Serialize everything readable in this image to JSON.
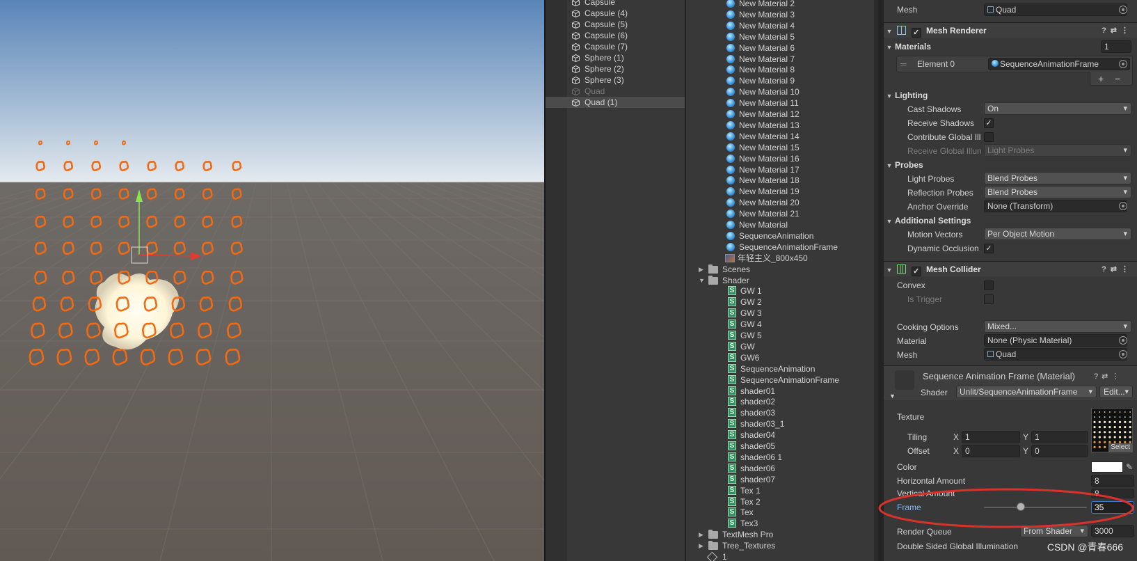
{
  "hierarchy": {
    "items": [
      {
        "label": "Capsule",
        "state": "normal"
      },
      {
        "label": "Capsule (4)",
        "state": "normal"
      },
      {
        "label": "Capsule (5)",
        "state": "normal"
      },
      {
        "label": "Capsule (6)",
        "state": "normal"
      },
      {
        "label": "Capsule (7)",
        "state": "normal"
      },
      {
        "label": "Sphere (1)",
        "state": "normal"
      },
      {
        "label": "Sphere (2)",
        "state": "normal"
      },
      {
        "label": "Sphere (3)",
        "state": "normal"
      },
      {
        "label": "Quad",
        "state": "disabled"
      },
      {
        "label": "Quad (1)",
        "state": "selected"
      }
    ]
  },
  "project": {
    "items": [
      {
        "label": "New Material 2",
        "icon": "sphere"
      },
      {
        "label": "New Material 3",
        "icon": "sphere"
      },
      {
        "label": "New Material 4",
        "icon": "sphere"
      },
      {
        "label": "New Material 5",
        "icon": "sphere"
      },
      {
        "label": "New Material 6",
        "icon": "sphere"
      },
      {
        "label": "New Material 7",
        "icon": "sphere"
      },
      {
        "label": "New Material 8",
        "icon": "sphere"
      },
      {
        "label": "New Material 9",
        "icon": "sphere"
      },
      {
        "label": "New Material 10",
        "icon": "sphere"
      },
      {
        "label": "New Material 11",
        "icon": "sphere"
      },
      {
        "label": "New Material 12",
        "icon": "sphere"
      },
      {
        "label": "New Material 13",
        "icon": "sphere"
      },
      {
        "label": "New Material 14",
        "icon": "sphere"
      },
      {
        "label": "New Material 15",
        "icon": "sphere"
      },
      {
        "label": "New Material 16",
        "icon": "sphere"
      },
      {
        "label": "New Material 17",
        "icon": "sphere"
      },
      {
        "label": "New Material 18",
        "icon": "sphere"
      },
      {
        "label": "New Material 19",
        "icon": "sphere"
      },
      {
        "label": "New Material 20",
        "icon": "sphere"
      },
      {
        "label": "New Material 21",
        "icon": "sphere"
      },
      {
        "label": "New Material",
        "icon": "sphere"
      },
      {
        "label": "SequenceAnimation",
        "icon": "sphere"
      },
      {
        "label": "SequenceAnimationFrame",
        "icon": "sphere"
      },
      {
        "label": "年轻主义_800x450",
        "icon": "image"
      },
      {
        "label": "Scenes",
        "icon": "folder",
        "expanded": false
      },
      {
        "label": "Shader",
        "icon": "folder",
        "expanded": true
      },
      {
        "label": "GW 1",
        "icon": "shader"
      },
      {
        "label": "GW 2",
        "icon": "shader"
      },
      {
        "label": "GW 3",
        "icon": "shader"
      },
      {
        "label": "GW 4",
        "icon": "shader"
      },
      {
        "label": "GW 5",
        "icon": "shader"
      },
      {
        "label": "GW",
        "icon": "shader"
      },
      {
        "label": "GW6",
        "icon": "shader"
      },
      {
        "label": "SequenceAnimation",
        "icon": "shader"
      },
      {
        "label": "SequenceAnimationFrame",
        "icon": "shader"
      },
      {
        "label": "shader01",
        "icon": "shader"
      },
      {
        "label": "shader02",
        "icon": "shader"
      },
      {
        "label": "shader03",
        "icon": "shader"
      },
      {
        "label": "shader03_1",
        "icon": "shader"
      },
      {
        "label": "shader04",
        "icon": "shader"
      },
      {
        "label": "shader05",
        "icon": "shader"
      },
      {
        "label": "shader06 1",
        "icon": "shader"
      },
      {
        "label": "shader06",
        "icon": "shader"
      },
      {
        "label": "shader07",
        "icon": "shader"
      },
      {
        "label": "Tex 1",
        "icon": "shader"
      },
      {
        "label": "Tex 2",
        "icon": "shader"
      },
      {
        "label": "Tex",
        "icon": "shader"
      },
      {
        "label": "Tex3",
        "icon": "shader"
      },
      {
        "label": "TextMesh Pro",
        "icon": "folder",
        "expanded": false
      },
      {
        "label": "Tree_Textures",
        "icon": "folder",
        "expanded": false
      },
      {
        "label": "1",
        "icon": "unity"
      }
    ]
  },
  "inspector": {
    "mesh_filter": {
      "mesh_label": "Mesh",
      "mesh_value": "Quad"
    },
    "mesh_renderer": {
      "title": "Mesh Renderer",
      "materials_label": "Materials",
      "materials_count": "1",
      "element0_label": "Element 0",
      "element0_value": "SequenceAnimationFrame",
      "lighting_label": "Lighting",
      "cast_shadows_label": "Cast Shadows",
      "cast_shadows_value": "On",
      "receive_shadows_label": "Receive Shadows",
      "contribute_gi_label": "Contribute Global Ill",
      "receive_gi_label": "Receive Global Illun",
      "receive_gi_value": "Light Probes",
      "probes_label": "Probes",
      "light_probes_label": "Light Probes",
      "light_probes_value": "Blend Probes",
      "reflection_probes_label": "Reflection Probes",
      "reflection_probes_value": "Blend Probes",
      "anchor_override_label": "Anchor Override",
      "anchor_override_value": "None (Transform)",
      "additional_label": "Additional Settings",
      "motion_vectors_label": "Motion Vectors",
      "motion_vectors_value": "Per Object Motion",
      "dynamic_occlusion_label": "Dynamic Occlusion"
    },
    "mesh_collider": {
      "title": "Mesh Collider",
      "convex_label": "Convex",
      "is_trigger_label": "Is Trigger",
      "cooking_label": "Cooking Options",
      "cooking_value": "Mixed...",
      "material_label": "Material",
      "material_value": "None (Physic Material)",
      "mesh_label": "Mesh",
      "mesh_value": "Quad"
    },
    "material": {
      "title": "Sequence Animation Frame (Material)",
      "shader_label": "Shader",
      "shader_value": "Unlit/SequenceAnimationFrame",
      "edit_label": "Edit...",
      "texture_label": "Texture",
      "select_label": "Select",
      "tiling_label": "Tiling",
      "offset_label": "Offset",
      "x_label": "X",
      "y_label": "Y",
      "tiling_x": "1",
      "tiling_y": "1",
      "offset_x": "0",
      "offset_y": "0",
      "color_label": "Color",
      "horizontal_label": "Horizontal Amount",
      "horizontal_value": "8",
      "vertical_label": "Vertical Amount",
      "vertical_value": "8",
      "frame_label": "Frame",
      "frame_value": "35",
      "frame_slider_fraction": 0.36,
      "render_queue_label": "Render Queue",
      "render_queue_mode": "From Shader",
      "render_queue_value": "3000",
      "double_sided_label": "Double Sided Global Illumination"
    },
    "colors": {
      "highlight_ring": "#d9322b",
      "frame_label": "#7eb6ff"
    }
  },
  "watermark": "CSDN @青春666"
}
